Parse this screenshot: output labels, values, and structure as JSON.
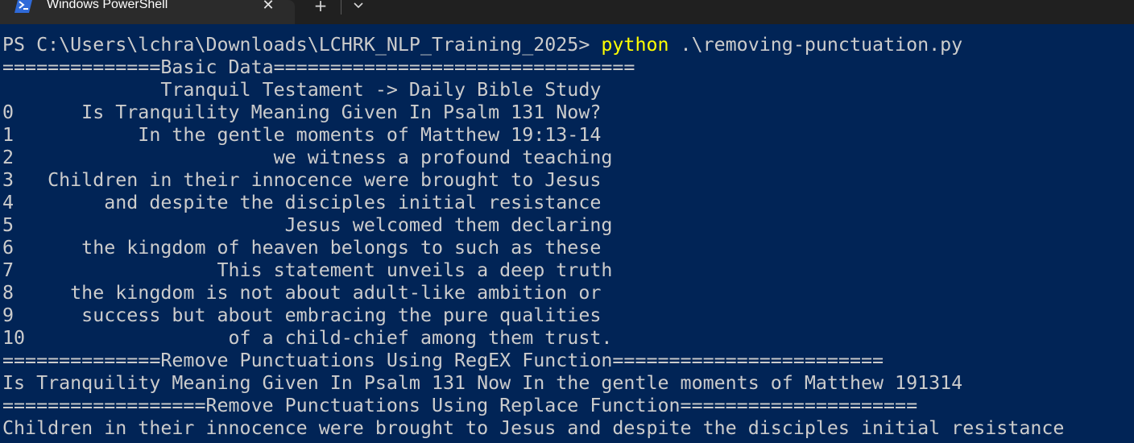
{
  "window": {
    "tab_title": "Windows PowerShell",
    "tab_icon": "powershell-icon",
    "close_icon": "close-icon",
    "new_tab_label": "+",
    "dropdown_icon": "chevron-down-icon"
  },
  "colors": {
    "console_background": "#012456",
    "console_text": "#cccccc",
    "command_text": "#ffff00",
    "tabbar_background": "#202020",
    "active_tab": "#2b2b2b"
  },
  "console": {
    "prompt": "PS C:\\Users\\lchra\\Downloads\\LCHRK_NLP_Training_2025> ",
    "command": "python",
    "command_args": " .\\removing-punctuation.py",
    "output_lines": [
      "==============Basic Data================================",
      "              Tranquil Testament -> Daily Bible Study",
      "0      Is Tranquility Meaning Given In Psalm 131 Now?",
      "1           In the gentle moments of Matthew 19:13-14",
      "2                       we witness a profound teaching",
      "3   Children in their innocence were brought to Jesus",
      "4        and despite the disciples initial resistance",
      "5                        Jesus welcomed them declaring",
      "6      the kingdom of heaven belongs to such as these",
      "7                  This statement unveils a deep truth",
      "8     the kingdom is not about adult-like ambition or",
      "9      success but about embracing the pure qualities",
      "10                  of a child-chief among them trust.",
      "==============Remove Punctuations Using RegEX Function========================",
      "Is Tranquility Meaning Given In Psalm 131 Now In the gentle moments of Matthew 191314",
      "==================Remove Punctuations Using Replace Function=====================",
      "Children in their innocence were brought to Jesus and despite the disciples initial resistance"
    ]
  }
}
